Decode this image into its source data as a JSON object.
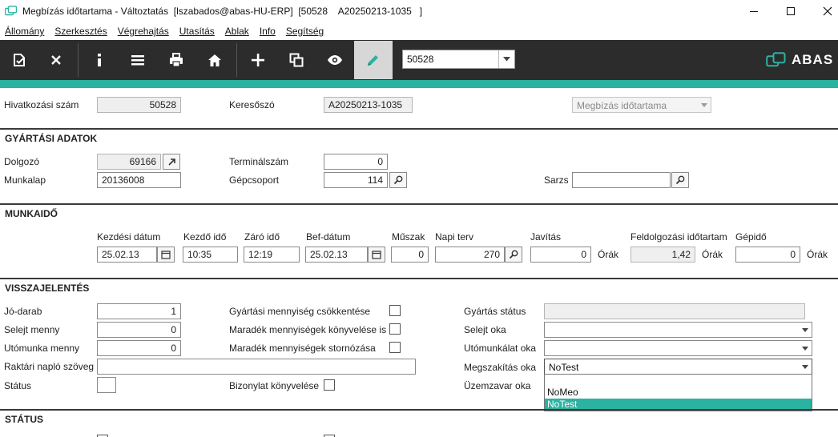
{
  "window": {
    "title": "Megbízás időtartama - Változtatás  [lszabados@abas-HU-ERP]  [50528    A20250213-1035   ]"
  },
  "menu": [
    {
      "label": "Állomány"
    },
    {
      "label": "Szerkesztés"
    },
    {
      "label": "Végrehajtás"
    },
    {
      "label": "Utasítás"
    },
    {
      "label": "Ablak"
    },
    {
      "label": "Info"
    },
    {
      "label": "Segítség"
    }
  ],
  "toolbar": {
    "record_combo_value": "50528",
    "brand": "ABAS",
    "icons": [
      "save-check-icon",
      "close-icon",
      "info-icon",
      "list-icon",
      "print-icon",
      "home-icon",
      "add-icon",
      "copy-icon",
      "view-icon",
      "edit-pencil-icon"
    ]
  },
  "colors": {
    "accent": "#2ab3a0",
    "toolbar": "#2c2c2c",
    "active_tool": "#d7d7d7"
  },
  "header": {
    "ref_label": "Hivatkozási szám",
    "ref_value": "50528",
    "search_label": "Keresőszó",
    "search_value": "A20250213-1035",
    "type_value": "Megbízás időtartama"
  },
  "production": {
    "title": "GYÁRTÁSI ADATOK",
    "worker_label": "Dolgozó",
    "worker_value": "69166",
    "terminal_label": "Terminálszám",
    "terminal_value": "0",
    "worksheet_label": "Munkalap",
    "worksheet_value": "20136008",
    "machine_group_label": "Gépcsoport",
    "machine_group_value": "114",
    "batch_label": "Sarzs",
    "batch_value": ""
  },
  "worktime": {
    "title": "MUNKAIDŐ",
    "start_date_label": "Kezdési dátum",
    "start_date_value": "25.02.13",
    "start_time_label": "Kezdő idő",
    "start_time_value": "10:35",
    "end_time_label": "Záró idő",
    "end_time_value": "12:19",
    "end_date_label": "Bef-dátum",
    "end_date_value": "25.02.13",
    "shift_label": "Műszak",
    "shift_value": "0",
    "plan_label": "Napi terv",
    "plan_value": "270",
    "correction_label": "Javítás",
    "correction_value": "0",
    "hours_unit": "Órák",
    "processing_label": "Feldolgozási időtartam",
    "processing_value": "1,42",
    "machine_time_label": "Gépidő",
    "machine_time_value": "0"
  },
  "feedback": {
    "title": "VISSZAJELENTÉS",
    "good_label": "Jó-darab",
    "good_value": "1",
    "scrap_label": "Selejt menny",
    "scrap_value": "0",
    "rework_label": "Utómunka menny",
    "rework_value": "0",
    "log_label": "Raktári napló szöveg",
    "log_value": "",
    "status_label": "Státus",
    "reduce_label": "Gyártási mennyiség csökkentése",
    "remaining_post_label": "Maradék mennyiségek könyvelése is",
    "remaining_cancel_label": "Maradék mennyiségek stornózása",
    "doc_post_label": "Bizonylat könyvelése",
    "prod_status_label": "Gyártás státus",
    "scrap_reason_label": "Selejt oka",
    "rework_reason_label": "Utómunkálat oka",
    "interrupt_reason_label": "Megszakítás oka",
    "interrupt_reason_value": "NoTest",
    "breakdown_reason_label": "Üzemzavar oka",
    "dropdown_options": [
      "",
      "NoMeo",
      "NoTest"
    ]
  },
  "status": {
    "title": "STÁTUS"
  }
}
